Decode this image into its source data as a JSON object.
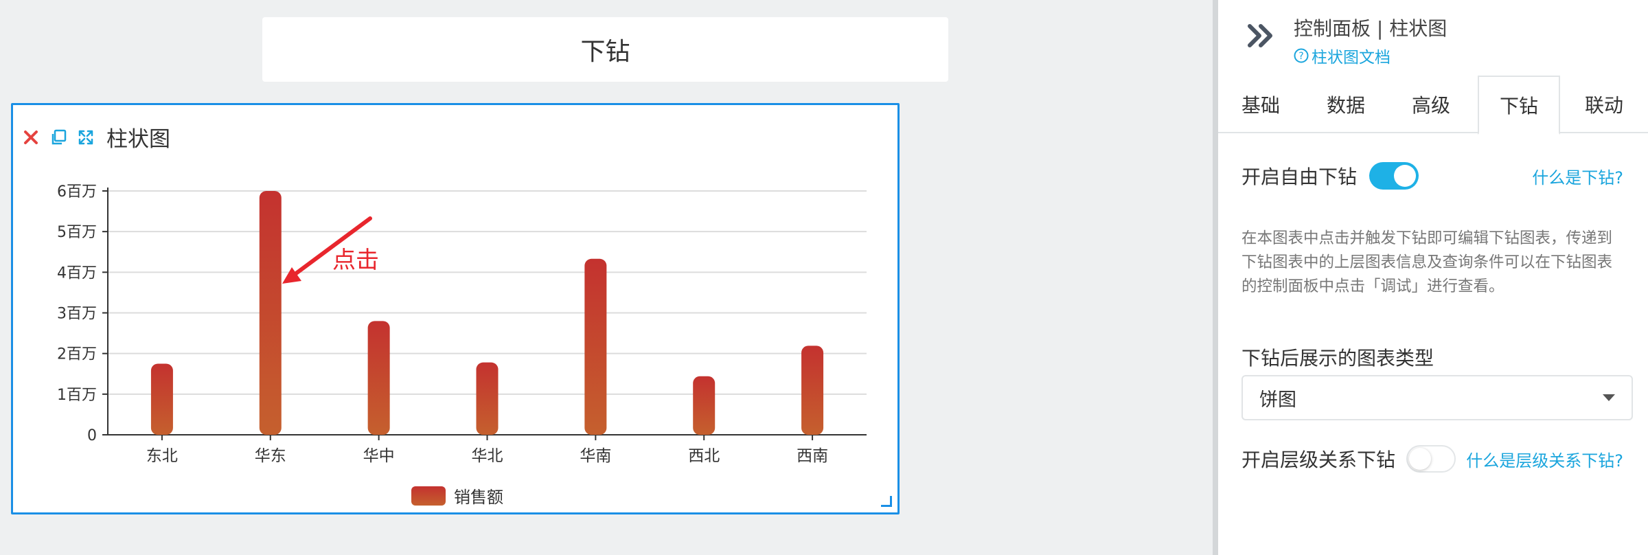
{
  "page": {
    "title": "下钻"
  },
  "chart_card": {
    "title": "柱状图",
    "icons": [
      "close-icon",
      "copy-icon",
      "expand-icon"
    ]
  },
  "annotation": {
    "text": "点击",
    "color": "#e8262d"
  },
  "chart_data": {
    "type": "bar",
    "categories": [
      "东北",
      "华东",
      "华中",
      "华北",
      "华南",
      "西北",
      "西南"
    ],
    "series": [
      {
        "name": "销售额",
        "values": [
          1750000,
          6000000,
          2800000,
          1780000,
          4330000,
          1440000,
          2190000
        ]
      }
    ],
    "ylim": [
      0,
      6000000
    ],
    "y_ticks": [
      {
        "value": 0,
        "label": "0"
      },
      {
        "value": 1000000,
        "label": "1百万"
      },
      {
        "value": 2000000,
        "label": "2百万"
      },
      {
        "value": 3000000,
        "label": "3百万"
      },
      {
        "value": 4000000,
        "label": "4百万"
      },
      {
        "value": 5000000,
        "label": "5百万"
      },
      {
        "value": 6000000,
        "label": "6百万"
      }
    ],
    "grid": true,
    "legend": "bottom-center",
    "colors": {
      "bar_top": "#c4322f",
      "bar_bottom": "#c5602e"
    }
  },
  "panel": {
    "title": "控制面板 | 柱状图",
    "doc_link": "柱状图文档",
    "tabs": [
      {
        "label": "基础",
        "active": false
      },
      {
        "label": "数据",
        "active": false
      },
      {
        "label": "高级",
        "active": false
      },
      {
        "label": "下钻",
        "active": true
      },
      {
        "label": "联动",
        "active": false
      }
    ],
    "free_drill": {
      "label": "开启自由下钻",
      "enabled": true,
      "help": "什么是下钻?"
    },
    "description": "在本图表中点击并触发下钻即可编辑下钻图表，传递到下钻图表中的上层图表信息及查询条件可以在下钻图表的控制面板中点击「调试」进行查看。",
    "chart_type": {
      "label": "下钻后展示的图表类型",
      "value": "饼图"
    },
    "hier_drill": {
      "label": "开启层级关系下钻",
      "enabled": false,
      "help": "什么是层级关系下钻?"
    }
  },
  "colors": {
    "accent": "#1aa5dd",
    "selection_border": "#1a8fe6"
  }
}
